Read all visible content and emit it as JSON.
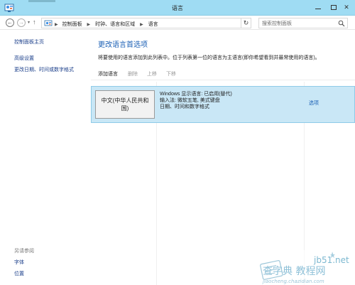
{
  "window": {
    "title": "语言",
    "minimize_label": "",
    "close_label": "✕"
  },
  "address_bar": {
    "back_glyph": "←",
    "forward_glyph": "→",
    "dropdown_glyph": "▾",
    "up_glyph": "↑",
    "breadcrumbs": [
      "控制面板",
      "时钟、语言和区域",
      "语言"
    ],
    "separator": "▶",
    "refresh_glyph": "↻",
    "search_placeholder": "搜索控制面板"
  },
  "sidebar": {
    "links": [
      "控制面板主页",
      "高级设置",
      "更改日期、时间或数字格式"
    ],
    "see_also_heading": "另请参阅",
    "see_also_links": [
      "字体",
      "位置"
    ]
  },
  "main": {
    "title": "更改语言首选项",
    "description": "将要使用的语言添加到此列表中。位于列表第一位的语言为主语言(即你希望看到并最常使用的语言)。",
    "toolbar": {
      "add": "添加语言",
      "remove": "删除",
      "move_up": "上移",
      "move_down": "下移"
    },
    "languages": [
      {
        "name": "中文(中华人民共和国)",
        "display_line": "Windows 显示语言: 已启用(替代)",
        "input_line": "输入法: 微软五笔, 美式键盘",
        "format_line": "日期、时间和数字格式",
        "options_label": "选项"
      }
    ]
  },
  "colors": {
    "titlebar": "#9fdcf3",
    "link": "#1a3e8a",
    "heading": "#1a5fb4",
    "selected_row": "#c9e7f6",
    "selected_border": "#8fcbe8"
  },
  "watermark_text": [
    "jb51.net",
    "查字典 教程网",
    "jiaocheng.chazidian.com"
  ]
}
